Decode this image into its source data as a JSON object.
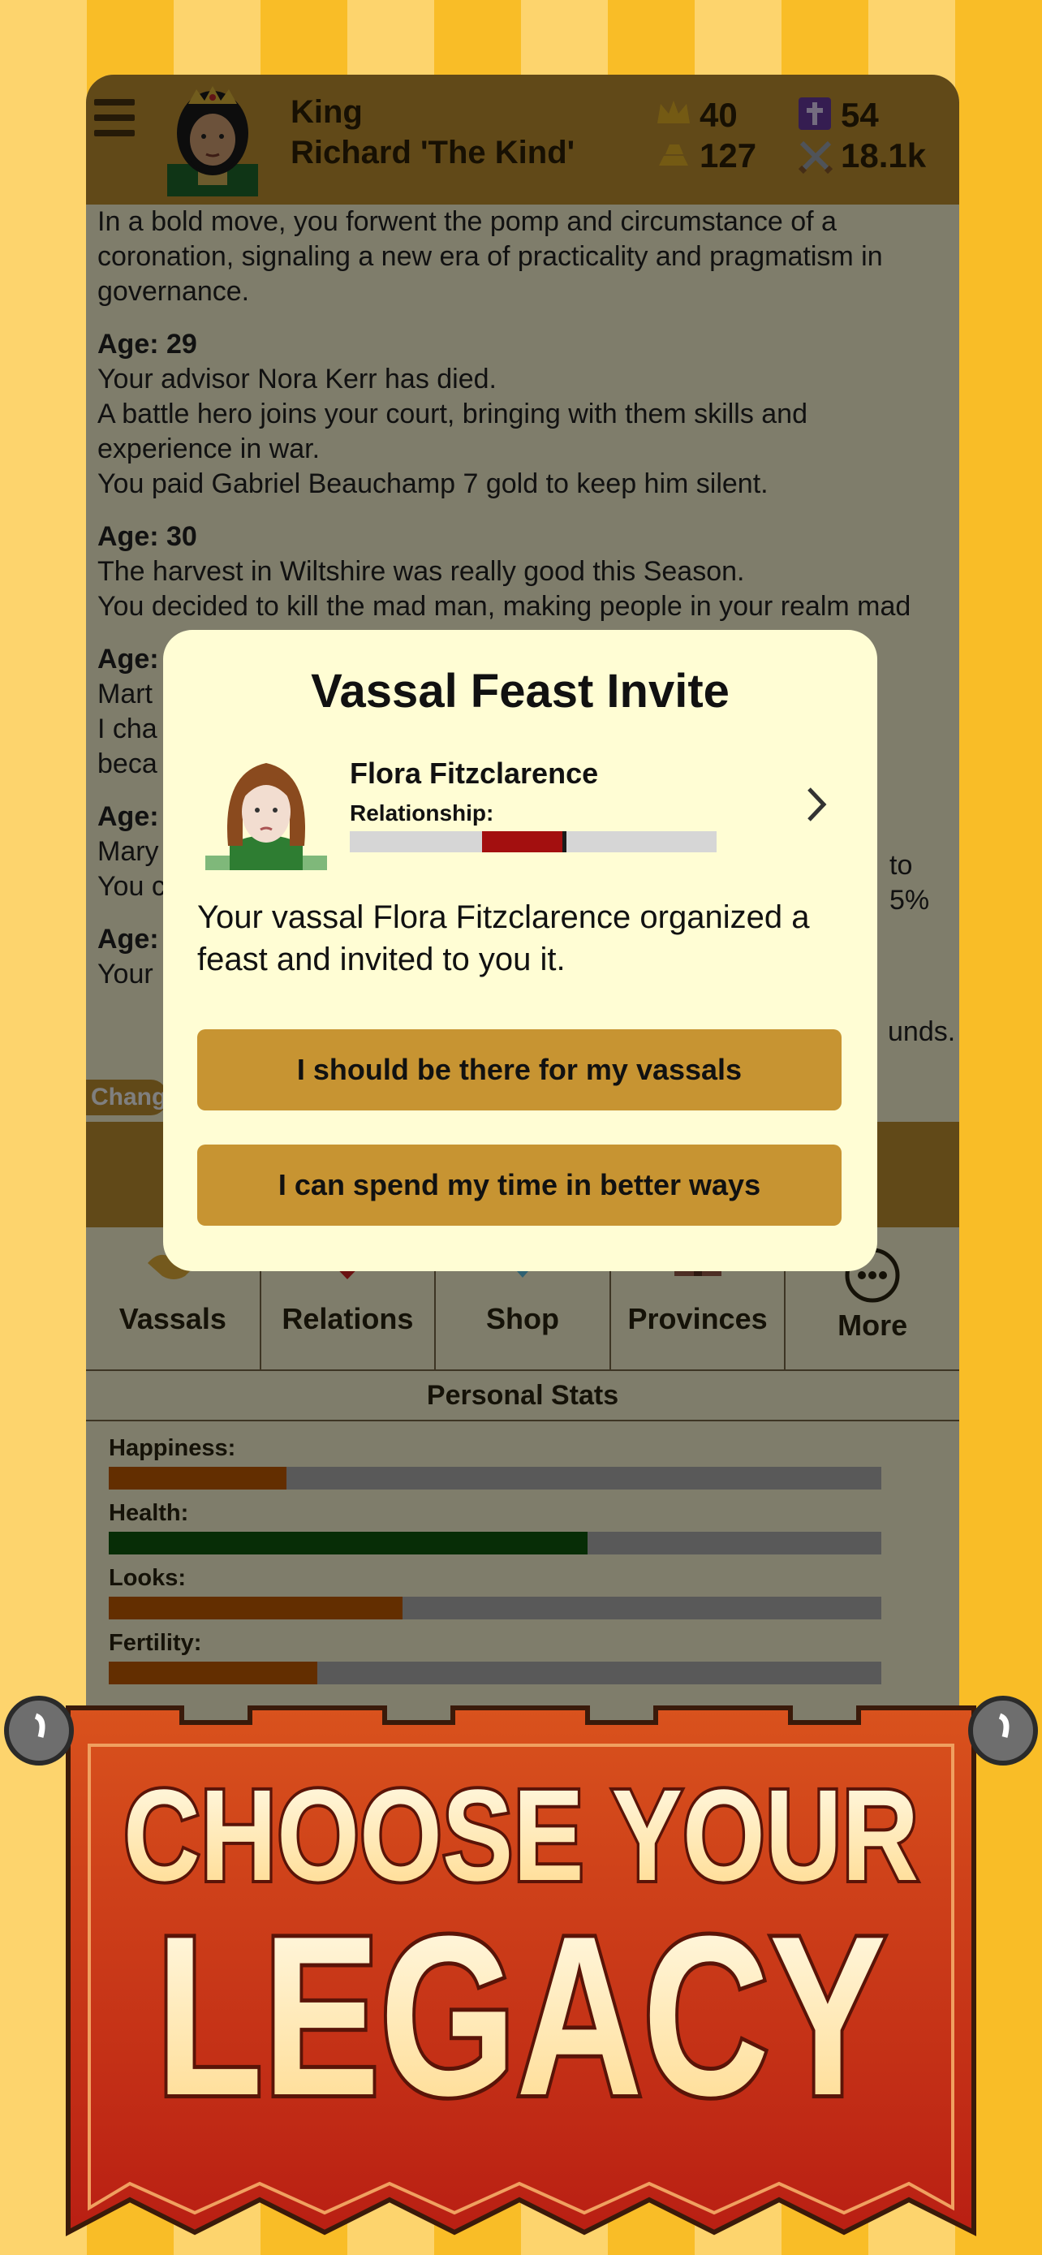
{
  "header": {
    "title_line1": "King",
    "title_line2": "Richard 'The Kind'",
    "stats": {
      "crown": "40",
      "faith": "54",
      "gold": "127",
      "army": "18.1k"
    }
  },
  "log": [
    {
      "age": "",
      "lines": [
        "In a bold move, you forwent the pomp and circumstance of a coronation, signaling a new era of practicality and pragmatism in governance."
      ]
    },
    {
      "age": "Age: 29",
      "lines": [
        "Your advisor Nora Kerr has died.",
        "A battle hero joins your court, bringing with them skills and experience in war.",
        "You paid Gabriel Beauchamp 7 gold to keep him silent."
      ]
    },
    {
      "age": "Age: 30",
      "lines": [
        "The harvest in Wiltshire was really good this Season.",
        "You decided to kill the mad man, making people in your realm mad"
      ]
    },
    {
      "age": "Age:",
      "lines": [
        "Mart",
        "I cha",
        "beca"
      ]
    },
    {
      "age": "Age:",
      "lines": [
        "Mary",
        "You c"
      ]
    },
    {
      "age": "Age:",
      "lines": [
        "Your"
      ]
    }
  ],
  "log_right_fragments": {
    "f1": "to 5%",
    "f2": "unds.",
    "f3": "."
  },
  "change_pill": "Chang",
  "tabs": [
    {
      "label": "Vassals",
      "icon": "handshake-icon"
    },
    {
      "label": "Relations",
      "icon": "heart-icon"
    },
    {
      "label": "Shop",
      "icon": "diamond-icon"
    },
    {
      "label": "Provinces",
      "icon": "castle-icon"
    },
    {
      "label": "More",
      "icon": "more-dots-icon"
    }
  ],
  "personal_stats": {
    "title": "Personal Stats",
    "items": [
      {
        "name": "Happiness:",
        "value": 0.23,
        "color": "#c75d00"
      },
      {
        "name": "Health:",
        "value": 0.62,
        "color": "#0e5b0d"
      },
      {
        "name": "Looks:",
        "value": 0.38,
        "color": "#c75d00"
      },
      {
        "name": "Fertility:",
        "value": 0.27,
        "color": "#c75d00"
      }
    ]
  },
  "modal": {
    "title": "Vassal Feast Invite",
    "vassal_name": "Flora Fitzclarence",
    "relationship_label": "Relationship:",
    "relationship_value": 0.58,
    "body": "Your vassal Flora Fitzclarence organized a feast and invited to you it.",
    "accept_label": "I should be there for my vassals",
    "decline_label": "I can spend my time in better ways"
  },
  "banner": {
    "line1": "CHOOSE YOUR",
    "line2": "LEGACY"
  },
  "colors": {
    "header": "#c39230",
    "button": "#c79432",
    "relationship": "#a30f0f",
    "banner": "#d2421a"
  }
}
